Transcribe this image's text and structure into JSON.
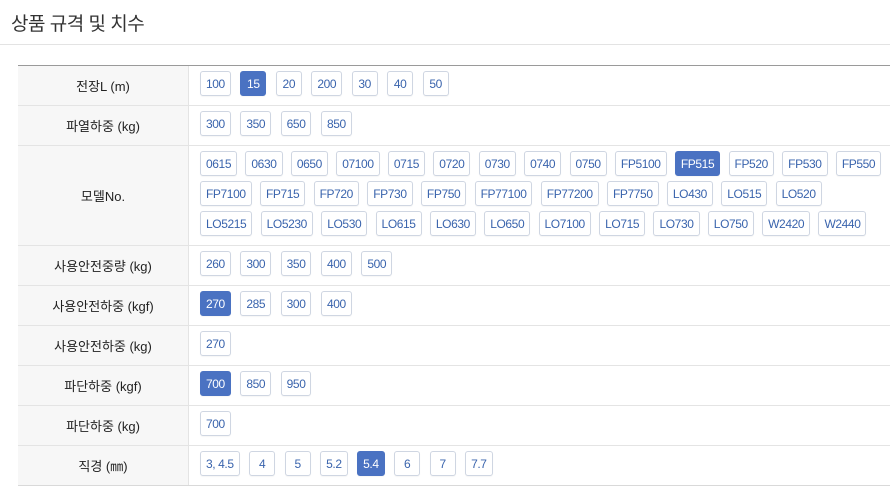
{
  "title": "상품 규격 및 치수",
  "accent_color": "#4a72c2",
  "rows": [
    {
      "label": "전장L (m)",
      "options": [
        "100",
        "15",
        "20",
        "200",
        "30",
        "40",
        "50"
      ],
      "selected": "15"
    },
    {
      "label": "파열하중 (kg)",
      "options": [
        "300",
        "350",
        "650",
        "850"
      ],
      "selected": null
    },
    {
      "label": "모델No.",
      "options": [
        "0615",
        "0630",
        "0650",
        "07100",
        "0715",
        "0720",
        "0730",
        "0740",
        "0750",
        "FP5100",
        "FP515",
        "FP520",
        "FP530",
        "FP550",
        "FP7100",
        "FP715",
        "FP720",
        "FP730",
        "FP750",
        "FP77100",
        "FP77200",
        "FP7750",
        "LO430",
        "LO515",
        "LO520",
        "LO5215",
        "LO5230",
        "LO530",
        "LO615",
        "LO630",
        "LO650",
        "LO7100",
        "LO715",
        "LO730",
        "LO750",
        "W2420",
        "W2440"
      ],
      "selected": "FP515"
    },
    {
      "label": "사용안전중량 (kg)",
      "options": [
        "260",
        "300",
        "350",
        "400",
        "500"
      ],
      "selected": null
    },
    {
      "label": "사용안전하중 (kgf)",
      "options": [
        "270",
        "285",
        "300",
        "400"
      ],
      "selected": "270"
    },
    {
      "label": "사용안전하중 (kg)",
      "options": [
        "270"
      ],
      "selected": null
    },
    {
      "label": "파단하중 (kgf)",
      "options": [
        "700",
        "850",
        "950"
      ],
      "selected": "700"
    },
    {
      "label": "파단하중 (kg)",
      "options": [
        "700"
      ],
      "selected": null
    },
    {
      "label": "직경 (㎜)",
      "options": [
        "3, 4.5",
        "4",
        "5",
        "5.2",
        "5.4",
        "6",
        "7",
        "7.7"
      ],
      "selected": "5.4"
    }
  ]
}
